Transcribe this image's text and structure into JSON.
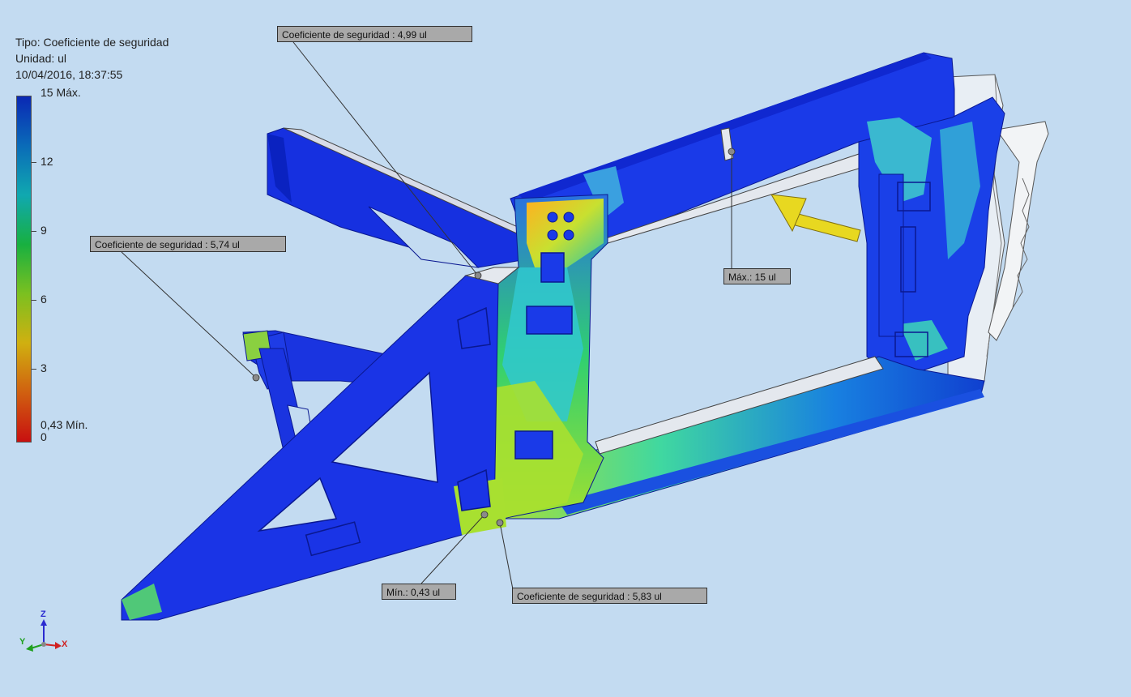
{
  "result": {
    "type_label": "Tipo: Coeficiente de seguridad",
    "unit_label": "Unidad: ul",
    "timestamp": "10/04/2016, 18:37:55"
  },
  "legend": {
    "max_label": "15 Máx.",
    "ticks": [
      "12",
      "9",
      "6",
      "3"
    ],
    "min_label": "0,43 Mín.",
    "zero_label": "0",
    "colors": [
      "#0a28b4",
      "#0a6bb8",
      "#10a8b0",
      "#18b040",
      "#7bc020",
      "#d0b010",
      "#d06010",
      "#c81010"
    ]
  },
  "callouts": {
    "top": "Coeficiente de seguridad : 4,99 ul",
    "left": "Coeficiente de seguridad : 5,74 ul",
    "max": "Máx.: 15 ul",
    "min": "Mín.: 0,43 ul",
    "bottom": "Coeficiente de seguridad : 5,83 ul"
  },
  "triad": {
    "x": "X",
    "y": "Y",
    "z": "Z"
  },
  "colors": {
    "background": "#c3dbf1",
    "load_arrow": "#e8d820",
    "high_safety": "#0a28d8"
  }
}
